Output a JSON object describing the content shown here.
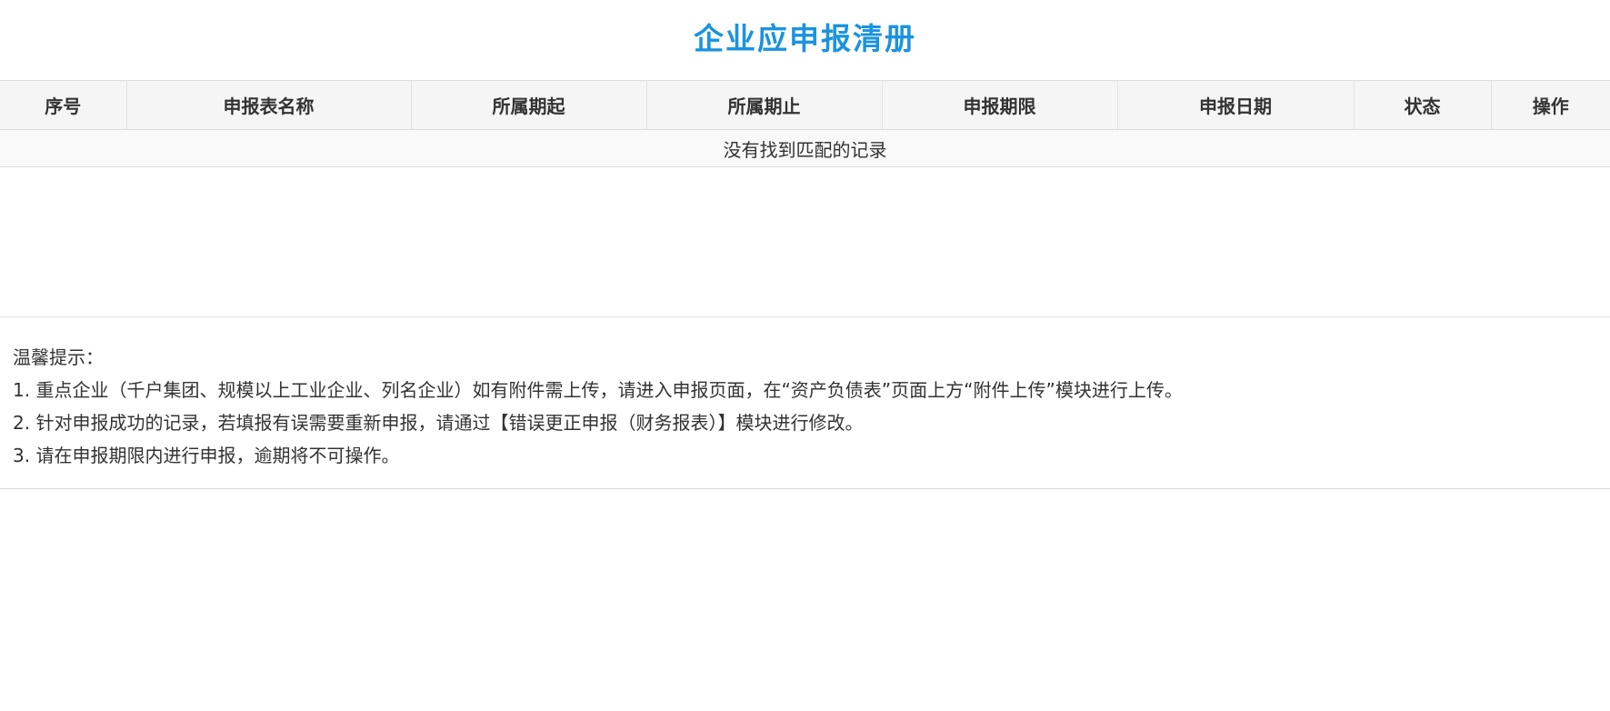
{
  "page": {
    "title": "企业应申报清册",
    "title_color": "#1a93e0"
  },
  "table": {
    "columns": [
      "序号",
      "申报表名称",
      "所属期起",
      "所属期止",
      "申报期限",
      "申报日期",
      "状态",
      "操作"
    ],
    "empty_message": "没有找到匹配的记录"
  },
  "tips": {
    "heading": "温馨提示：",
    "lines": [
      "1. 重点企业（千户集团、规模以上工业企业、列名企业）如有附件需上传，请进入申报页面，在“资产负债表”页面上方“附件上传”模块进行上传。",
      "2. 针对申报成功的记录，若填报有误需要重新申报，请通过【错误更正申报（财务报表）】模块进行修改。",
      "3. 请在申报期限内进行申报，逾期将不可操作。"
    ]
  }
}
